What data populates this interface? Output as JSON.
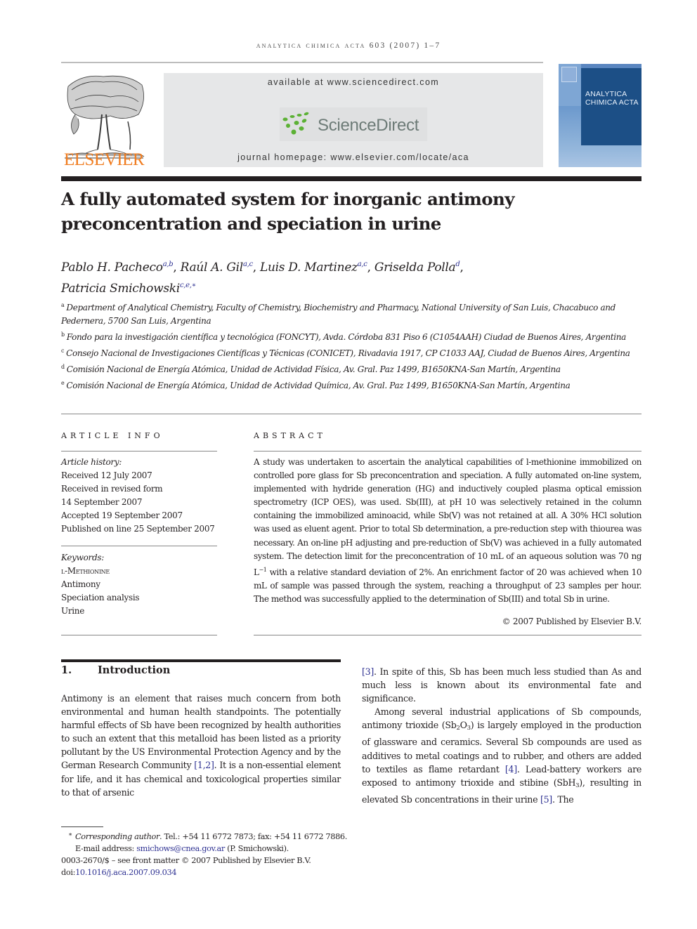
{
  "running_header": "analytica chimica acta 603 (2007) 1–7",
  "publisher": {
    "logo_word": "ELSEVIER",
    "banner_top": "available at www.sciencedirect.com",
    "platform_name": "ScienceDirect",
    "banner_bottom": "journal homepage: www.elsevier.com/locate/aca",
    "brand_colors": {
      "elsevier_orange": "#f07c1f",
      "sciencedirect_green": "#5cb135",
      "cover_blue": "#1c4f86"
    }
  },
  "cover": {
    "line1": "ANALYTICA",
    "line2": "CHIMICA ACTA"
  },
  "title": "A fully automated system for inorganic antimony preconcentration and speciation in urine",
  "authors": [
    {
      "name": "Pablo H. Pacheco",
      "affils": "a,b",
      "sep": ", "
    },
    {
      "name": "Raúl A. Gil",
      "affils": "a,c",
      "sep": ", "
    },
    {
      "name": "Luis D. Martinez",
      "affils": "a,c",
      "sep": ", "
    },
    {
      "name": "Griselda Polla",
      "affils": "d",
      "sep": ","
    },
    {
      "name": "Patricia Smichowski",
      "affils": "c,e,∗",
      "sep": ""
    }
  ],
  "affiliations": [
    {
      "key": "a",
      "text": "Department of Analytical Chemistry, Faculty of Chemistry, Biochemistry and Pharmacy, National University of San Luis, Chacabuco and Pedernera, 5700 San Luis, Argentina"
    },
    {
      "key": "b",
      "text": "Fondo para la investigación científica y tecnológica (FONCYT), Avda. Córdoba 831 Piso 6 (C1054AAH) Ciudad de Buenos Aires, Argentina"
    },
    {
      "key": "c",
      "text": "Consejo Nacional de Investigaciones Científicas y Técnicas (CONICET), Rivadavia 1917, CP C1033 AAJ, Ciudad de Buenos Aires, Argentina"
    },
    {
      "key": "d",
      "text": "Comisión Nacional de Energía Atómica, Unidad de Actividad Física, Av. Gral. Paz 1499, B1650KNA-San Martín, Argentina"
    },
    {
      "key": "e",
      "text": "Comisión Nacional de Energía Atómica, Unidad de Actividad Química, Av. Gral. Paz 1499, B1650KNA-San Martín, Argentina"
    }
  ],
  "article_info": {
    "label": "Article Info",
    "history_label": "Article history:",
    "history": [
      "Received 12 July 2007",
      "Received in revised form",
      "14 September 2007",
      "Accepted 19 September 2007",
      "Published on line 25 September 2007"
    ],
    "keywords_label": "Keywords:",
    "keywords": [
      "l-Methionine",
      "Antimony",
      "Speciation analysis",
      "Urine"
    ]
  },
  "abstract": {
    "label": "Abstract",
    "text_before_unit": "A study was undertaken to ascertain the analytical capabilities of l-methionine immobilized on controlled pore glass for Sb preconcentration and speciation. A fully automated on-line system, implemented with hydride generation (HG) and inductively coupled plasma optical emission spectrometry (ICP OES), was used. Sb(III), at pH 10 was selectively retained in the column containing the immobilized aminoacid, while Sb(V) was not retained at all. A 30% HCl solution was used as eluent agent. Prior to total Sb determination, a pre-reduction step with thiourea was necessary. An on-line pH adjusting and pre-reduction of Sb(V) was achieved in a fully automated system. The detection limit for the preconcentration of 10 mL of an aqueous solution was 70 ng L",
    "unit_exponent": "−1",
    "text_after_unit": " with a relative standard deviation of 2%. An enrichment factor of 20 was achieved when 10 mL of sample was passed through the system, reaching a throughput of 23 samples per hour. The method was successfully applied to the determination of Sb(III) and total Sb in urine.",
    "copyright": "© 2007 Published by Elsevier B.V."
  },
  "introduction": {
    "number": "1.",
    "heading": "Introduction",
    "p1_a": "Antimony is an element that raises much concern from both environmental and human health standpoints. The potentially harmful effects of Sb have been recognized by health authorities to such an extent that this metalloid has been listed as a priority pollutant by the US Environmental Protection Agency and by the German Research Community ",
    "p1_cite1": "[1,2]",
    "p1_b": ". It is a non-essential element for life, and it has chemical and toxicological properties similar to that of arsenic ",
    "p1_cite2": "[3]",
    "p1_c": ". In spite of this, Sb has been much less studied than As and much less is known about its environmental fate and significance.",
    "p2_a": "Among several industrial applications of Sb compounds, antimony trioxide (Sb",
    "p2_sub1": "2",
    "p2_b": "O",
    "p2_sub2": "3",
    "p2_c": ") is largely employed in the production of glassware and ceramics. Several Sb compounds are used as additives to metal coatings and to rubber, and others are added to textiles as flame retardant ",
    "p2_cite1": "[4]",
    "p2_d": ". Lead-battery workers are exposed to antimony trioxide and stibine (SbH",
    "p2_sub3": "3",
    "p2_e": "), resulting in elevated Sb concentrations in their urine ",
    "p2_cite2": "[5]",
    "p2_f": ". The"
  },
  "footnotes": {
    "star": "*",
    "corr_label": "Corresponding author",
    "corr_text": ". Tel.: +54 11 6772 7873; fax: +54 11 6772 7886.",
    "email_label": "E-mail address: ",
    "email": "smichows@cnea.gov.ar",
    "email_owner": " (P. Smichowski).",
    "issn_line": "0003-2670/$ – see front matter © 2007 Published by Elsevier B.V.",
    "doi_label": "doi:",
    "doi": "10.1016/j.aca.2007.09.034"
  }
}
